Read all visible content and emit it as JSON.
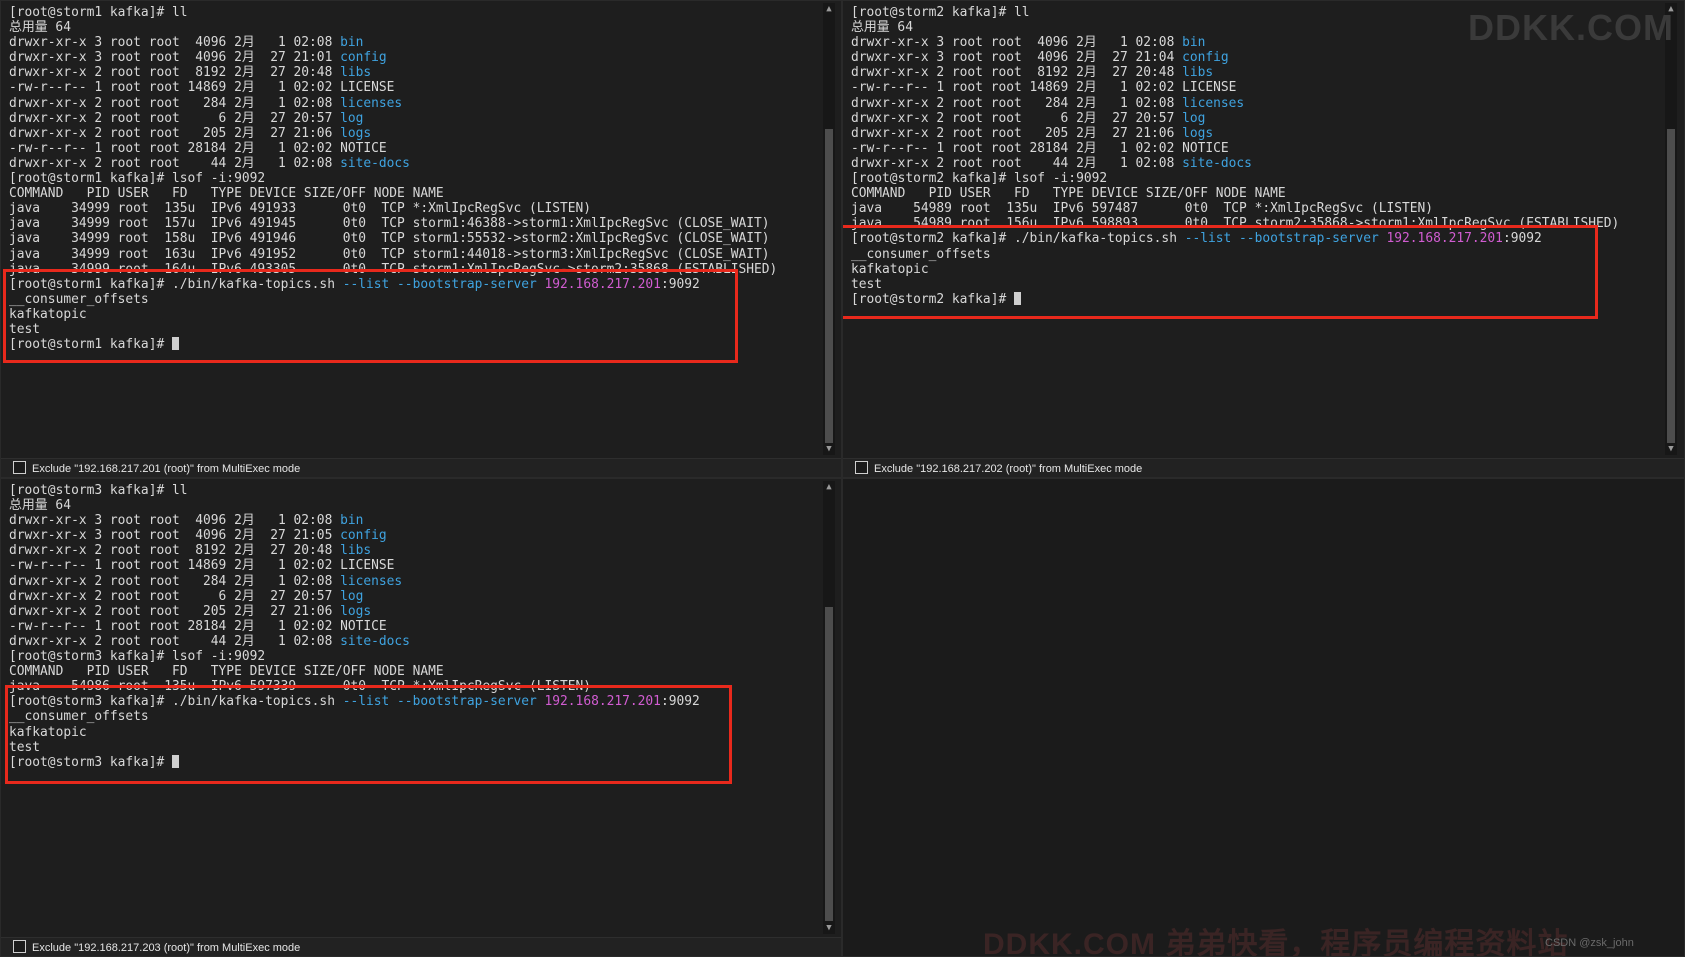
{
  "colors": {
    "background": "#1e1e1e",
    "text": "#d8d8d8",
    "directory_blue": "#3fa3e0",
    "ip_magenta": "#d15cd1",
    "highlight_red": "#e8291c"
  },
  "pane_tl": {
    "lines": [
      [
        {
          "t": "[root@storm1 kafka]# ll"
        }
      ],
      [
        {
          "t": "总用量 64"
        }
      ],
      [
        {
          "t": "drwxr-xr-x 3 root root  4096 2月   1 02:08 "
        },
        {
          "t": "bin",
          "c": "blue"
        }
      ],
      [
        {
          "t": "drwxr-xr-x 3 root root  4096 2月  27 21:01 "
        },
        {
          "t": "config",
          "c": "blue"
        }
      ],
      [
        {
          "t": "drwxr-xr-x 2 root root  8192 2月  27 20:48 "
        },
        {
          "t": "libs",
          "c": "blue"
        }
      ],
      [
        {
          "t": "-rw-r--r-- 1 root root 14869 2月   1 02:02 LICENSE"
        }
      ],
      [
        {
          "t": "drwxr-xr-x 2 root root   284 2月   1 02:08 "
        },
        {
          "t": "licenses",
          "c": "blue"
        }
      ],
      [
        {
          "t": "drwxr-xr-x 2 root root     6 2月  27 20:57 "
        },
        {
          "t": "log",
          "c": "blue"
        }
      ],
      [
        {
          "t": "drwxr-xr-x 2 root root   205 2月  27 21:06 "
        },
        {
          "t": "logs",
          "c": "blue"
        }
      ],
      [
        {
          "t": "-rw-r--r-- 1 root root 28184 2月   1 02:02 NOTICE"
        }
      ],
      [
        {
          "t": "drwxr-xr-x 2 root root    44 2月   1 02:08 "
        },
        {
          "t": "site-docs",
          "c": "blue"
        }
      ],
      [
        {
          "t": "[root@storm1 kafka]# lsof -i:9092"
        }
      ],
      [
        {
          "t": "COMMAND   PID USER   FD   TYPE DEVICE SIZE/OFF NODE NAME"
        }
      ],
      [
        {
          "t": "java    34999 root  135u  IPv6 491933      0t0  TCP *:XmlIpcRegSvc (LISTEN)"
        }
      ],
      [
        {
          "t": "java    34999 root  157u  IPv6 491945      0t0  TCP storm1:46388->storm1:XmlIpcRegSvc (CLOSE_WAIT)"
        }
      ],
      [
        {
          "t": "java    34999 root  158u  IPv6 491946      0t0  TCP storm1:55532->storm2:XmlIpcRegSvc (CLOSE_WAIT)"
        }
      ],
      [
        {
          "t": "java    34999 root  163u  IPv6 491952      0t0  TCP storm1:44018->storm3:XmlIpcRegSvc (CLOSE_WAIT)"
        }
      ],
      [
        {
          "t": "java    34999 root  164u  IPv6 493305      0t0  TCP storm1:XmlIpcRegSvc->storm2:35868 (ESTABLISHED)"
        }
      ],
      [
        {
          "t": "[root@storm1 kafka]# ./bin/kafka-topics.sh "
        },
        {
          "t": "--list --bootstrap-server",
          "c": "blue"
        },
        {
          "t": " "
        },
        {
          "t": "192.168.217.201",
          "c": "mag"
        },
        {
          "t": ":9092"
        }
      ],
      [
        {
          "t": "__consumer_offsets"
        }
      ],
      [
        {
          "t": "kafkatopic"
        }
      ],
      [
        {
          "t": "test"
        }
      ],
      [
        {
          "t": "[root@storm1 kafka]# "
        },
        {
          "cursor": true
        }
      ]
    ],
    "footer_label": "Exclude \"192.168.217.201 (root)\" from MultiExec mode"
  },
  "pane_tr": {
    "lines": [
      [
        {
          "t": "[root@storm2 kafka]# ll"
        }
      ],
      [
        {
          "t": "总用量 64"
        }
      ],
      [
        {
          "t": "drwxr-xr-x 3 root root  4096 2月   1 02:08 "
        },
        {
          "t": "bin",
          "c": "blue"
        }
      ],
      [
        {
          "t": "drwxr-xr-x 3 root root  4096 2月  27 21:04 "
        },
        {
          "t": "config",
          "c": "blue"
        }
      ],
      [
        {
          "t": "drwxr-xr-x 2 root root  8192 2月  27 20:48 "
        },
        {
          "t": "libs",
          "c": "blue"
        }
      ],
      [
        {
          "t": "-rw-r--r-- 1 root root 14869 2月   1 02:02 LICENSE"
        }
      ],
      [
        {
          "t": "drwxr-xr-x 2 root root   284 2月   1 02:08 "
        },
        {
          "t": "licenses",
          "c": "blue"
        }
      ],
      [
        {
          "t": "drwxr-xr-x 2 root root     6 2月  27 20:57 "
        },
        {
          "t": "log",
          "c": "blue"
        }
      ],
      [
        {
          "t": "drwxr-xr-x 2 root root   205 2月  27 21:06 "
        },
        {
          "t": "logs",
          "c": "blue"
        }
      ],
      [
        {
          "t": "-rw-r--r-- 1 root root 28184 2月   1 02:02 NOTICE"
        }
      ],
      [
        {
          "t": "drwxr-xr-x 2 root root    44 2月   1 02:08 "
        },
        {
          "t": "site-docs",
          "c": "blue"
        }
      ],
      [
        {
          "t": "[root@storm2 kafka]# lsof -i:9092"
        }
      ],
      [
        {
          "t": "COMMAND   PID USER   FD   TYPE DEVICE SIZE/OFF NODE NAME"
        }
      ],
      [
        {
          "t": "java    54989 root  135u  IPv6 597487      0t0  TCP *:XmlIpcRegSvc (LISTEN)"
        }
      ],
      [
        {
          "t": "java    54989 root  156u  IPv6 598893      0t0  TCP storm2:35868->storm1:XmlIpcRegSvc (ESTABLISHED)"
        }
      ],
      [
        {
          "t": "[root@storm2 kafka]# ./bin/kafka-topics.sh "
        },
        {
          "t": "--list --bootstrap-server",
          "c": "blue"
        },
        {
          "t": " "
        },
        {
          "t": "192.168.217.201",
          "c": "mag"
        },
        {
          "t": ":9092"
        }
      ],
      [
        {
          "t": "__consumer_offsets"
        }
      ],
      [
        {
          "t": "kafkatopic"
        }
      ],
      [
        {
          "t": "test"
        }
      ],
      [
        {
          "t": "[root@storm2 kafka]# "
        },
        {
          "cursor": true
        }
      ]
    ],
    "footer_label": "Exclude \"192.168.217.202 (root)\" from MultiExec mode"
  },
  "pane_bl": {
    "lines": [
      [
        {
          "t": "[root@storm3 kafka]# ll"
        }
      ],
      [
        {
          "t": "总用量 64"
        }
      ],
      [
        {
          "t": "drwxr-xr-x 3 root root  4096 2月   1 02:08 "
        },
        {
          "t": "bin",
          "c": "blue"
        }
      ],
      [
        {
          "t": "drwxr-xr-x 3 root root  4096 2月  27 21:05 "
        },
        {
          "t": "config",
          "c": "blue"
        }
      ],
      [
        {
          "t": "drwxr-xr-x 2 root root  8192 2月  27 20:48 "
        },
        {
          "t": "libs",
          "c": "blue"
        }
      ],
      [
        {
          "t": "-rw-r--r-- 1 root root 14869 2月   1 02:02 LICENSE"
        }
      ],
      [
        {
          "t": "drwxr-xr-x 2 root root   284 2月   1 02:08 "
        },
        {
          "t": "licenses",
          "c": "blue"
        }
      ],
      [
        {
          "t": "drwxr-xr-x 2 root root     6 2月  27 20:57 "
        },
        {
          "t": "log",
          "c": "blue"
        }
      ],
      [
        {
          "t": "drwxr-xr-x 2 root root   205 2月  27 21:06 "
        },
        {
          "t": "logs",
          "c": "blue"
        }
      ],
      [
        {
          "t": "-rw-r--r-- 1 root root 28184 2月   1 02:02 NOTICE"
        }
      ],
      [
        {
          "t": "drwxr-xr-x 2 root root    44 2月   1 02:08 "
        },
        {
          "t": "site-docs",
          "c": "blue"
        }
      ],
      [
        {
          "t": "[root@storm3 kafka]# lsof -i:9092"
        }
      ],
      [
        {
          "t": "COMMAND   PID USER   FD   TYPE DEVICE SIZE/OFF NODE NAME"
        }
      ],
      [
        {
          "t": "java    54986 root  135u  IPv6 597339      0t0  TCP *:XmlIpcRegSvc (LISTEN)"
        }
      ],
      [
        {
          "t": "[root@storm3 kafka]# ./bin/kafka-topics.sh "
        },
        {
          "t": "--list --bootstrap-server",
          "c": "blue"
        },
        {
          "t": " "
        },
        {
          "t": "192.168.217.201",
          "c": "mag"
        },
        {
          "t": ":9092"
        }
      ],
      [
        {
          "t": "__consumer_offsets"
        }
      ],
      [
        {
          "t": "kafkatopic"
        }
      ],
      [
        {
          "t": "test"
        }
      ],
      [
        {
          "t": "[root@storm3 kafka]# "
        },
        {
          "cursor": true
        }
      ]
    ],
    "footer_label": "Exclude \"192.168.217.203 (root)\" from MultiExec mode"
  },
  "icons": {
    "scroll_up": "▲",
    "scroll_down": "▼"
  },
  "watermarks": {
    "top_right": "DDKK.COM",
    "bottom": "DDKK.COM 弟弟快看，程序员编程资料站",
    "csdn": "CSDN @zsk_john"
  }
}
